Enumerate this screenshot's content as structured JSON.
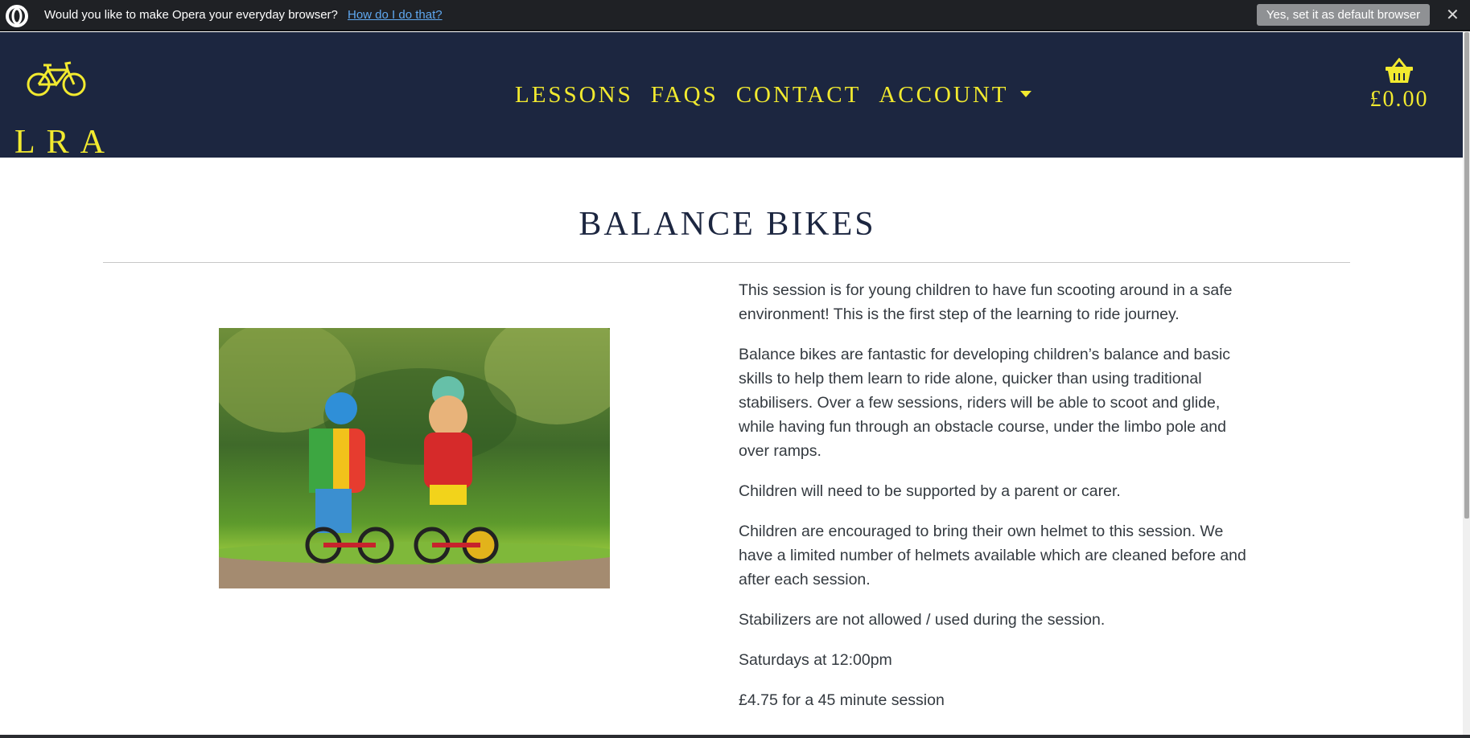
{
  "infobar": {
    "message": "Would you like to make Opera your everyday browser?",
    "help_link": "How do I do that?",
    "default_button": "Yes, set it as default browser",
    "close_symbol": "✕"
  },
  "header": {
    "logo_text": "LRA",
    "nav": [
      "LESSONS",
      "FAQS",
      "CONTACT",
      "ACCOUNT"
    ],
    "basket_total": "£0.00",
    "colors": {
      "background": "#1c2640",
      "accent": "#f2ea2f"
    }
  },
  "main": {
    "title": "BALANCE BIKES",
    "paragraphs": [
      "This session is for young children to have fun scooting around in a safe environment! This is the first step of the learning to ride journey.",
      "Balance bikes are fantastic for developing children’s balance and basic skills to help them learn to ride alone, quicker than using traditional stabilisers. Over a few sessions, riders will be able to scoot and glide, while having fun through an obstacle course, under the limbo pole and over ramps.",
      "Children will need to be supported by a parent or carer.",
      "Children are encouraged to bring their own helmet to this session. We have a limited number of helmets available which are cleaned before and after each session.",
      "Stabilizers are not allowed / used during the session.",
      "Saturdays at 12:00pm",
      "£4.75 for a 45 minute session"
    ]
  }
}
